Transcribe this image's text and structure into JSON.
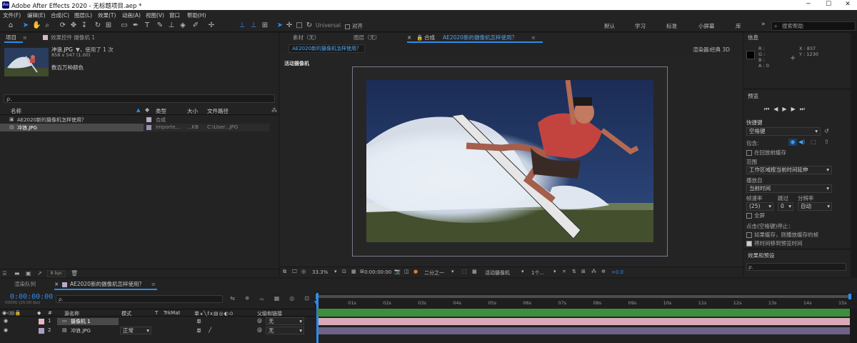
{
  "window": {
    "title": "Adobe After Effects 2020 - 无标题项目.aep *",
    "app_badge": "Ae",
    "minimize": "─",
    "maximize": "☐",
    "close": "✕"
  },
  "menu": [
    "文件(F)",
    "编辑(E)",
    "合成(C)",
    "图层(L)",
    "效果(T)",
    "动画(A)",
    "视图(V)",
    "窗口",
    "帮助(H)"
  ],
  "toolbar": {
    "universal": "Universal",
    "align_label": "对齐",
    "workspaces": [
      "默认",
      "学习",
      "标准",
      "小屏幕",
      "库"
    ],
    "more": "»",
    "search_help": "搜索帮助"
  },
  "project_panel": {
    "tab_project": "项目",
    "tab_effects": "效果控件 摄像机 1",
    "item_name": "冲浪.JPG",
    "item_used": "▼，使用了 1 次",
    "item_dims": "858 x 547 (1.00)",
    "item_colors": "数百万种颜色",
    "search_placeholder": "ρ.",
    "columns": {
      "name": "名称",
      "type": "类型",
      "size": "大小",
      "path": "文件路径"
    },
    "rows": [
      {
        "name": "AE2020新的摄像机怎样使用？",
        "type": "合成",
        "size": "",
        "path": "",
        "color": "#b9a9c8"
      },
      {
        "name": "冲浪.JPG",
        "type": "Importe...",
        "size": "...KB",
        "path": "C:\\User...JPG",
        "color": "#9c8fb5"
      }
    ],
    "bpc": "8 bpc"
  },
  "viewer": {
    "tab_footage": "素材（无）",
    "tab_layer": "图层（无）",
    "tab_comp": "合成",
    "comp_name": "AE2020新的摄像机怎样使用？",
    "breadcrumb": "AE2020新的摄像机怎样使用？",
    "renderer_label": "渲染器:",
    "renderer_value": "经典 3D",
    "active_camera": "活动摄像机",
    "zoom": "33.3%",
    "timecode": "0:00:00:00",
    "resolution": "二分之一",
    "camera_dd": "活动摄像机",
    "views": "1个...",
    "exposure": "+0.0"
  },
  "info": {
    "title": "信息",
    "r": "R :",
    "g": "G :",
    "b": "B :",
    "a": "A : 0",
    "x": "X : 837",
    "y": "Y : 1230"
  },
  "preview": {
    "title": "预览",
    "shortcut_label": "快捷键",
    "shortcut_value": "空格键",
    "include_label": "包含:",
    "cache_before": "在回放前缓存",
    "range_label": "范围",
    "range_value": "工作区域按当前时间延伸",
    "play_from_label": "播放自",
    "play_from_value": "当前时间",
    "fps_label": "帧速率",
    "skip_label": "跳过",
    "resolution_label": "分辨率",
    "fps_value": "(25)",
    "skip_value": "0",
    "resolution_value": "自动",
    "fullscreen": "全屏",
    "stop_label": "点击(空格键)停止：",
    "if_cached": "如果缓存，则播放缓存的帧",
    "move_time": "将时间移到预览时间"
  },
  "effects_presets": {
    "title": "效果和预设",
    "search": "ρ."
  },
  "timeline": {
    "tab_render": "渲染队列",
    "tab_comp": "AE2020新的摄像机怎样使用？",
    "timecode": "0:00:00:00",
    "frames": "00000 (25.00 fps)",
    "search_placeholder": "ρ.",
    "columns": {
      "layer_name": "源名称",
      "mode": "模式",
      "t": "T",
      "trkmat": "TrkMat",
      "parent": "父级和链接"
    },
    "layers": [
      {
        "num": "1",
        "name": "摄像机 1",
        "mode": "",
        "parent": "无",
        "color": "#e7b4c4"
      },
      {
        "num": "2",
        "name": "冲浪.JPG",
        "mode": "正常",
        "parent": "无",
        "color": "#a99dc4"
      }
    ],
    "ruler": [
      "0s",
      "01s",
      "02s",
      "03s",
      "04s",
      "05s",
      "06s",
      "07s",
      "08s",
      "09s",
      "10s",
      "11s",
      "12s",
      "13s",
      "14s",
      "15s"
    ]
  },
  "colors": {
    "accent": "#2d8ceb",
    "comp_header_text": "#4fa4f0",
    "camera_bar": "#d9a9b8",
    "footage_bar": "#6e6287",
    "workarea_green": "#3c8f3c"
  }
}
